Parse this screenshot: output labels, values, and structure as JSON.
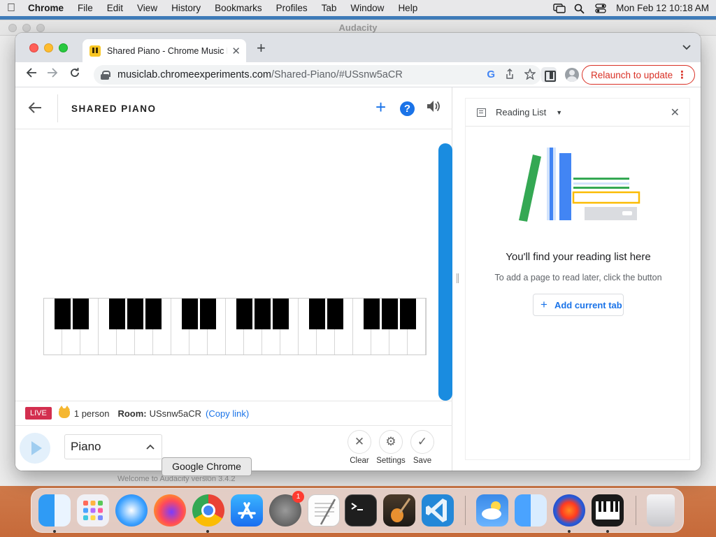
{
  "menubar": {
    "app": "Chrome",
    "items": [
      "File",
      "Edit",
      "View",
      "History",
      "Bookmarks",
      "Profiles",
      "Tab",
      "Window",
      "Help"
    ],
    "datetime": "Mon Feb 12  10:18 AM"
  },
  "background_window": {
    "title": "Audacity",
    "footer_text": "Welcome to Audacity version 3.4.2"
  },
  "chrome": {
    "tab_title": "Shared Piano - Chrome Music Lab",
    "url_host": "musiclab.chromeexperiments.com",
    "url_path": "/Shared-Piano/#USsnw5aCR",
    "relaunch_label": "Relaunch to update"
  },
  "piano": {
    "title": "SHARED PIANO",
    "live_label": "LIVE",
    "people": "1 person",
    "room_label": "Room:",
    "room_id": "USsnw5aCR",
    "copy_link": "(Copy link)",
    "instrument": "Piano",
    "controls": {
      "clear": "Clear",
      "settings": "Settings",
      "save": "Save"
    },
    "colors": {
      "accent": "#1a73e8",
      "scrollbar": "#1a8ce0",
      "live": "#d32f4f"
    }
  },
  "reading_list": {
    "title": "Reading List",
    "heading": "You'll find your reading list here",
    "subtext": "To add a page to read later, click the button",
    "add_button": "Add current tab"
  },
  "dock": {
    "tooltip": "Google Chrome",
    "items": [
      "Finder",
      "Launchpad",
      "Safari",
      "Firefox",
      "Google Chrome",
      "App Store",
      "System Settings",
      "TextEdit",
      "Terminal",
      "GarageBand",
      "Visual Studio Code",
      "Weather",
      "Migration Assistant",
      "Audacity",
      "Piano App",
      "Trash"
    ],
    "settings_badge": "1"
  }
}
